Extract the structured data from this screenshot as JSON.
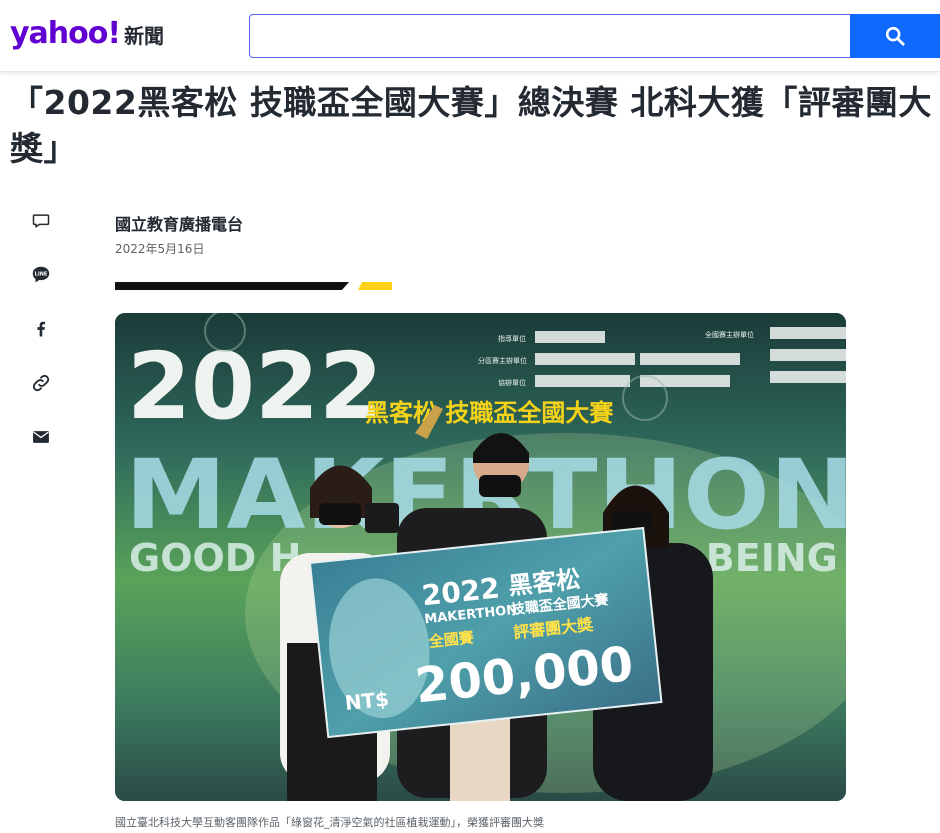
{
  "header": {
    "logo_brand": "yahoo!",
    "logo_section": "新聞",
    "search_value": "",
    "search_icon": "search-icon"
  },
  "article": {
    "title": "「2022黑客松 技職盃全國大賽」總決賽 北科大獲「評審團大獎」",
    "author": "國立教育廣播電台",
    "date": "2022年5月16日"
  },
  "share": [
    {
      "name": "comment-icon"
    },
    {
      "name": "line-icon",
      "label": "LINE"
    },
    {
      "name": "facebook-icon",
      "label": "f"
    },
    {
      "name": "link-icon"
    },
    {
      "name": "mail-icon"
    }
  ],
  "photo": {
    "backdrop_year": "2022",
    "backdrop_event": "黑客松 技職盃全國大賽",
    "backdrop_main": "MAKERTHON",
    "backdrop_sub_left": "GOOD H",
    "backdrop_sub_right": "-BEING",
    "sponsors": [
      "指導單位",
      "全國賽主辦單位",
      "分區賽主辦單位",
      "協辦單位"
    ],
    "board_year": "2022",
    "board_title": "黑客松",
    "board_makerthon": "MAKERTHON",
    "board_sub": "技職盃全國大賽",
    "board_level": "全國賽",
    "board_award": "評審團大獎",
    "board_currency": "NT$",
    "board_amount": "200,000"
  },
  "caption": "國立臺北科技大學互動客團隊作品「綠窗花_清淨空氣的社區植栽運動」，榮獲評審團大獎",
  "colors": {
    "brand": "#6001d2",
    "search_button": "#0f69ff",
    "rule_black": "#111111",
    "rule_yellow": "#ffd217"
  }
}
